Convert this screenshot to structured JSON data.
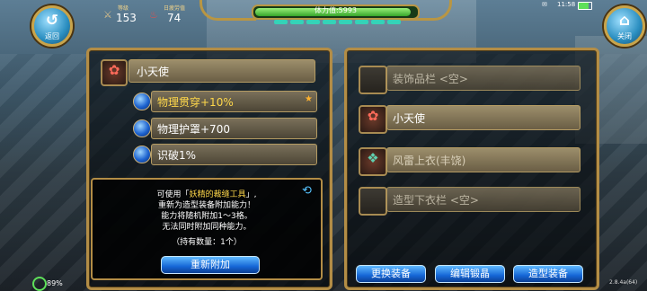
{
  "hud": {
    "back_label": "返回",
    "close_label": "关闭",
    "level_caption": "等级",
    "level_value": "153",
    "fatigue_caption": "日疲劳值",
    "fatigue_value": "74",
    "stamina_text": "体力值:5993",
    "stamina_fraction": 0.99,
    "stamina_segments": 8,
    "clock": "11:58",
    "battery_label": "89%",
    "version": "2.8.4a(64)"
  },
  "left_panel": {
    "item_name": "小天使",
    "stats": [
      {
        "label": "物理贯穿+10%",
        "highlight": true,
        "star": "★"
      },
      {
        "label": "物理护罩+700",
        "highlight": false,
        "star": ""
      },
      {
        "label": "识破1%",
        "highlight": false,
        "star": ""
      }
    ],
    "info_lines": {
      "line1_pre": "可使用「",
      "line1_item": "妖精的裁缝工具",
      "line1_post": "」,",
      "line2": "重新为造型装备附加能力！",
      "line3": "能力将随机附加1～3格。",
      "line4": "无法同时附加同种能力。",
      "line5": "（持有数量：1个）"
    },
    "reattach_button": "重新附加"
  },
  "right_panel": {
    "slots": [
      {
        "label": "装饰品栏 <空>",
        "filled": false,
        "icon": "empty-slot"
      },
      {
        "label": "小天使",
        "filled": true,
        "icon": "angel-icon"
      },
      {
        "label": "风雷上衣(丰饶)",
        "filled": true,
        "icon": "robe-icon"
      },
      {
        "label": "造型下衣栏 <空>",
        "filled": false,
        "icon": "empty-slot"
      }
    ],
    "buttons": {
      "change": "更换装备",
      "edit": "编辑锻晶",
      "style": "造型装备"
    }
  },
  "colors": {
    "gold": "#b38d46",
    "highlight_text": "#ffd84a",
    "button_blue": "#1566d6"
  }
}
